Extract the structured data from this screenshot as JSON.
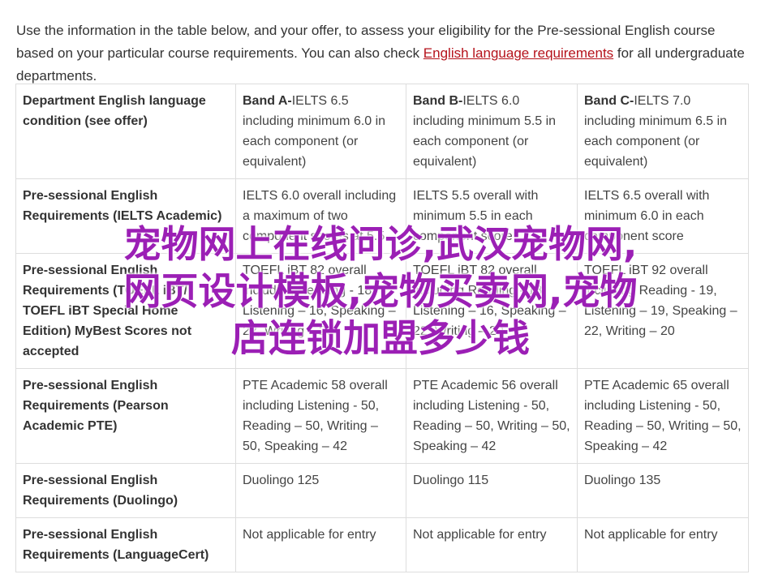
{
  "intro": {
    "text_before": "Use the information in the table below, and your offer, to assess your eligibility for the Pre-sessional English course based on your particular course requirements. You can also check ",
    "link": "English language requirements",
    "text_after": " for all undergraduate departments."
  },
  "table": {
    "rows": [
      {
        "label": "Department English language condition (see offer)",
        "cells": [
          {
            "bold": "Band A-",
            "text": "IELTS 6.5 including minimum 6.0 in each component (or equivalent)"
          },
          {
            "bold": "Band B-",
            "text": "IELTS 6.0 including minimum 5.5 in each component (or equivalent)"
          },
          {
            "bold": "Band C-",
            "text": "IELTS 7.0 including minimum 6.5 in each component (or equivalent)"
          }
        ]
      },
      {
        "label": "Pre-sessional English Requirements (IELTS Academic)",
        "cells": [
          {
            "bold": "",
            "text": "IELTS 6.0 overall including a maximum of two component scores at 5.5"
          },
          {
            "bold": "",
            "text": "IELTS 5.5 overall with minimum 5.5 in each component score"
          },
          {
            "bold": "",
            "text": "IELTS 6.5 overall with minimum 6.0 in each component score"
          }
        ]
      },
      {
        "label": "Pre-sessional English Requirements (TOEFL iBT/ TOEFL iBT Special Home Edition) MyBest Scores not accepted",
        "cells": [
          {
            "bold": "",
            "text": "TOEFL iBT 82 overall including Reading - 18, Listening – 16, Speaking – 22, Writing – 20"
          },
          {
            "bold": "",
            "text": "TOEFL iBT 82 overall including Reading - 18, Listening – 16, Speaking – 22, Writing – 20"
          },
          {
            "bold": "",
            "text": "TOEFL iBT 92 overall including Reading - 19, Listening – 19, Speaking – 22, Writing – 20"
          }
        ]
      },
      {
        "label": "Pre-sessional English Requirements (Pearson Academic PTE)",
        "cells": [
          {
            "bold": "",
            "text": "PTE Academic 58 overall including Listening - 50, Reading – 50, Writing – 50, Speaking – 42"
          },
          {
            "bold": "",
            "text": "PTE Academic 56 overall including Listening - 50, Reading – 50, Writing – 50, Speaking – 42"
          },
          {
            "bold": "",
            "text": "PTE Academic 65 overall including Listening - 50, Reading – 50, Writing – 50, Speaking – 42"
          }
        ]
      },
      {
        "label": "Pre-sessional English Requirements (Duolingo)",
        "cells": [
          {
            "bold": "",
            "text": "Duolingo 125"
          },
          {
            "bold": "",
            "text": "Duolingo 115"
          },
          {
            "bold": "",
            "text": "Duolingo 135"
          }
        ]
      },
      {
        "label": "Pre-sessional English Requirements (LanguageCert)",
        "cells": [
          {
            "bold": "",
            "text": "Not applicable for entry"
          },
          {
            "bold": "",
            "text": "Not applicable for entry"
          },
          {
            "bold": "",
            "text": "Not applicable for entry"
          }
        ]
      }
    ]
  },
  "watermark": {
    "line1": "宠物网上在线问诊,武汉宠物网,",
    "line2": "网页设计模板,宠物买卖网,宠物",
    "line3": "店连锁加盟多少钱",
    "color": "#9b1fb5"
  }
}
